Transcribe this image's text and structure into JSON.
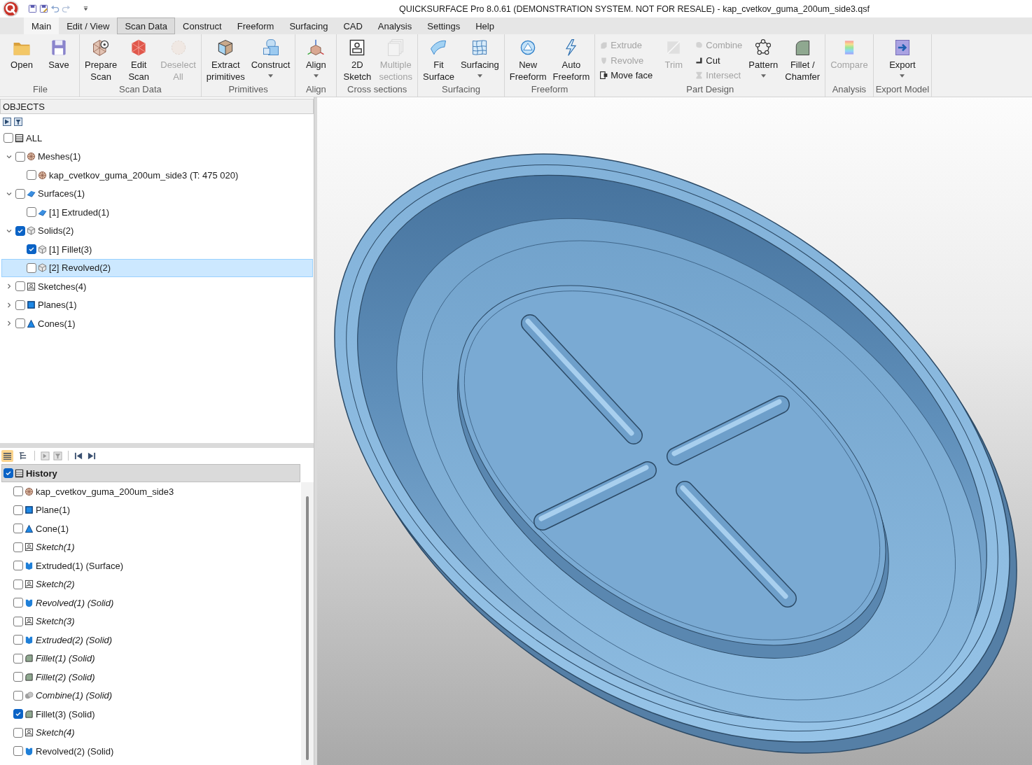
{
  "window": {
    "title": "QUICKSURFACE Pro 8.0.61 (DEMONSTRATION SYSTEM. NOT FOR RESALE) - kap_cvetkov_guma_200um_side3.qsf"
  },
  "menu_tabs": [
    {
      "label": "Main",
      "selected": true,
      "highlighted": false
    },
    {
      "label": "Edit / View",
      "selected": false,
      "highlighted": false
    },
    {
      "label": "Scan Data",
      "selected": false,
      "highlighted": true
    },
    {
      "label": "Construct",
      "selected": false,
      "highlighted": false
    },
    {
      "label": "Freeform",
      "selected": false,
      "highlighted": false
    },
    {
      "label": "Surfacing",
      "selected": false,
      "highlighted": false
    },
    {
      "label": "CAD",
      "selected": false,
      "highlighted": false
    },
    {
      "label": "Analysis",
      "selected": false,
      "highlighted": false
    },
    {
      "label": "Settings",
      "selected": false,
      "highlighted": false
    },
    {
      "label": "Help",
      "selected": false,
      "highlighted": false
    }
  ],
  "ribbon": {
    "groups": [
      {
        "label": "File",
        "tools": [
          {
            "kind": "large",
            "label": "Open",
            "disabled": false,
            "dropdown": false
          },
          {
            "kind": "large",
            "label": "Save",
            "disabled": false,
            "dropdown": false
          }
        ]
      },
      {
        "label": "Scan Data",
        "tools": [
          {
            "kind": "large",
            "label": "Prepare\nScan",
            "disabled": false,
            "dropdown": false
          },
          {
            "kind": "large",
            "label": "Edit\nScan",
            "disabled": false,
            "dropdown": false
          },
          {
            "kind": "large",
            "label": "Deselect\nAll",
            "disabled": true,
            "dropdown": false
          }
        ]
      },
      {
        "label": "Primitives",
        "tools": [
          {
            "kind": "large",
            "label": "Extract\nprimitives",
            "disabled": false,
            "dropdown": false
          },
          {
            "kind": "large",
            "label": "Construct",
            "disabled": false,
            "dropdown": true
          }
        ]
      },
      {
        "label": "Align",
        "tools": [
          {
            "kind": "large",
            "label": "Align",
            "disabled": false,
            "dropdown": true
          }
        ]
      },
      {
        "label": "Cross sections",
        "tools": [
          {
            "kind": "large",
            "label": "2D\nSketch",
            "disabled": false,
            "dropdown": false
          },
          {
            "kind": "large",
            "label": "Multiple\nsections",
            "disabled": true,
            "dropdown": false
          }
        ]
      },
      {
        "label": "Surfacing",
        "tools": [
          {
            "kind": "large",
            "label": "Fit\nSurface",
            "disabled": false,
            "dropdown": false
          },
          {
            "kind": "large",
            "label": "Surfacing",
            "disabled": false,
            "dropdown": true
          }
        ]
      },
      {
        "label": "Freeform",
        "tools": [
          {
            "kind": "large",
            "label": "New\nFreeform",
            "disabled": false,
            "dropdown": false
          },
          {
            "kind": "large",
            "label": "Auto\nFreeform",
            "disabled": false,
            "dropdown": false
          }
        ]
      },
      {
        "label": "Part Design",
        "tools": [
          {
            "kind": "stack",
            "items": [
              {
                "label": "Extrude",
                "disabled": true
              },
              {
                "label": "Revolve",
                "disabled": true
              },
              {
                "label": "Move face",
                "disabled": false
              }
            ]
          },
          {
            "kind": "large",
            "label": "Trim",
            "disabled": true,
            "dropdown": false
          },
          {
            "kind": "stack",
            "items": [
              {
                "label": "Combine",
                "disabled": true
              },
              {
                "label": "Cut",
                "disabled": false
              },
              {
                "label": "Intersect",
                "disabled": true
              }
            ]
          },
          {
            "kind": "large",
            "label": "Pattern",
            "disabled": false,
            "dropdown": true
          },
          {
            "kind": "large",
            "label": "Fillet /\nChamfer",
            "disabled": false,
            "dropdown": false
          }
        ]
      },
      {
        "label": "Analysis",
        "tools": [
          {
            "kind": "large",
            "label": "Compare",
            "disabled": true,
            "dropdown": false
          }
        ]
      },
      {
        "label": "Export Model",
        "tools": [
          {
            "kind": "large",
            "label": "Export",
            "disabled": false,
            "dropdown": true
          }
        ]
      }
    ]
  },
  "objects": {
    "title": "OBJECTS",
    "all": {
      "label": "ALL",
      "checked": false
    },
    "tree": [
      {
        "label": "Meshes(1)",
        "kind": "mesh",
        "checked": false,
        "selected": false,
        "expanded": true,
        "children": [
          {
            "label": "kap_cvetkov_guma_200um_side3 (T: 475 020)",
            "kind": "mesh",
            "checked": false,
            "selected": false
          }
        ]
      },
      {
        "label": "Surfaces(1)",
        "kind": "surface",
        "checked": false,
        "selected": false,
        "expanded": true,
        "children": [
          {
            "label": "[1] Extruded(1)",
            "kind": "surface",
            "checked": false,
            "selected": false
          }
        ]
      },
      {
        "label": "Solids(2)",
        "kind": "solid",
        "checked": true,
        "selected": false,
        "expanded": true,
        "children": [
          {
            "label": "[1] Fillet(3)",
            "kind": "solid",
            "checked": true,
            "selected": false
          },
          {
            "label": "[2] Revolved(2)",
            "kind": "solid",
            "checked": false,
            "selected": true
          }
        ]
      },
      {
        "label": "Sketches(4)",
        "kind": "sketch",
        "checked": false,
        "selected": false,
        "expanded": false
      },
      {
        "label": "Planes(1)",
        "kind": "plane",
        "checked": false,
        "selected": false,
        "expanded": false
      },
      {
        "label": "Cones(1)",
        "kind": "cone",
        "checked": false,
        "selected": false,
        "expanded": false
      }
    ]
  },
  "history": {
    "title": "History",
    "checked": true,
    "view_modes": [
      {
        "selected": true
      },
      {
        "selected": false
      }
    ],
    "items": [
      {
        "label": "kap_cvetkov_guma_200um_side3",
        "kind": "mesh",
        "checked": false,
        "inactive": false
      },
      {
        "label": "Plane(1)",
        "kind": "plane",
        "checked": false,
        "inactive": false
      },
      {
        "label": "Cone(1)",
        "kind": "cone",
        "checked": false,
        "inactive": false
      },
      {
        "label": "Sketch(1)",
        "kind": "sketch",
        "checked": false,
        "inactive": true
      },
      {
        "label": "Extruded(1) (Surface)",
        "kind": "extrude",
        "checked": false,
        "inactive": false
      },
      {
        "label": "Sketch(2)",
        "kind": "sketch",
        "checked": false,
        "inactive": true
      },
      {
        "label": "Revolved(1) (Solid)",
        "kind": "revolve",
        "checked": false,
        "inactive": true
      },
      {
        "label": "Sketch(3)",
        "kind": "sketch",
        "checked": false,
        "inactive": true
      },
      {
        "label": "Extruded(2) (Solid)",
        "kind": "extrude",
        "checked": false,
        "inactive": true
      },
      {
        "label": "Fillet(1) (Solid)",
        "kind": "fillet",
        "checked": false,
        "inactive": true
      },
      {
        "label": "Fillet(2) (Solid)",
        "kind": "fillet",
        "checked": false,
        "inactive": true
      },
      {
        "label": "Combine(1) (Solid)",
        "kind": "combine",
        "checked": false,
        "inactive": true
      },
      {
        "label": "Fillet(3) (Solid)",
        "kind": "fillet",
        "checked": true,
        "inactive": false
      },
      {
        "label": "Sketch(4)",
        "kind": "sketch",
        "checked": false,
        "inactive": true
      },
      {
        "label": "Revolved(2) (Solid)",
        "kind": "revolve",
        "checked": false,
        "inactive": false
      }
    ]
  }
}
